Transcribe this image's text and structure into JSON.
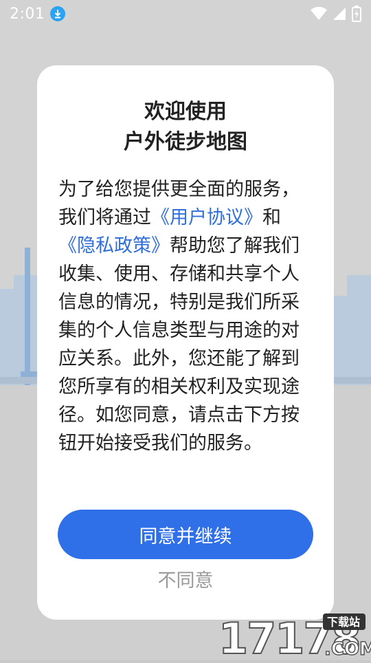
{
  "status_bar": {
    "time": "2:01",
    "icons": [
      "download-badge-icon",
      "wifi-icon",
      "cell-signal-icon",
      "battery-charging-icon"
    ]
  },
  "dialog": {
    "title_line1": "欢迎使用",
    "title_line2": "户外徒步地图",
    "body": {
      "part1": "为了给您提供更全面的服务，我们将通过",
      "link_user_agreement": "《用户协议》",
      "part2": "和",
      "link_privacy_policy": "《隐私政策》",
      "part3": "帮助您了解我们收集、使用、存储和共享个人信息的情况，特别是我们所采集的个人信息类型与用途的对应关系。此外，您还能了解到您所享有的相关权利及实现途径。如您同意，请点击下方按钮开始接受我们的服务。"
    },
    "agree_label": "同意并继续",
    "disagree_label": "不同意"
  },
  "watermark": {
    "digits": "17178",
    "suffix": ".COM",
    "tag": "下载站"
  },
  "colors": {
    "accent": "#2f6fe8",
    "link": "#2f6fdc",
    "backdrop": "#c9c9c9"
  }
}
